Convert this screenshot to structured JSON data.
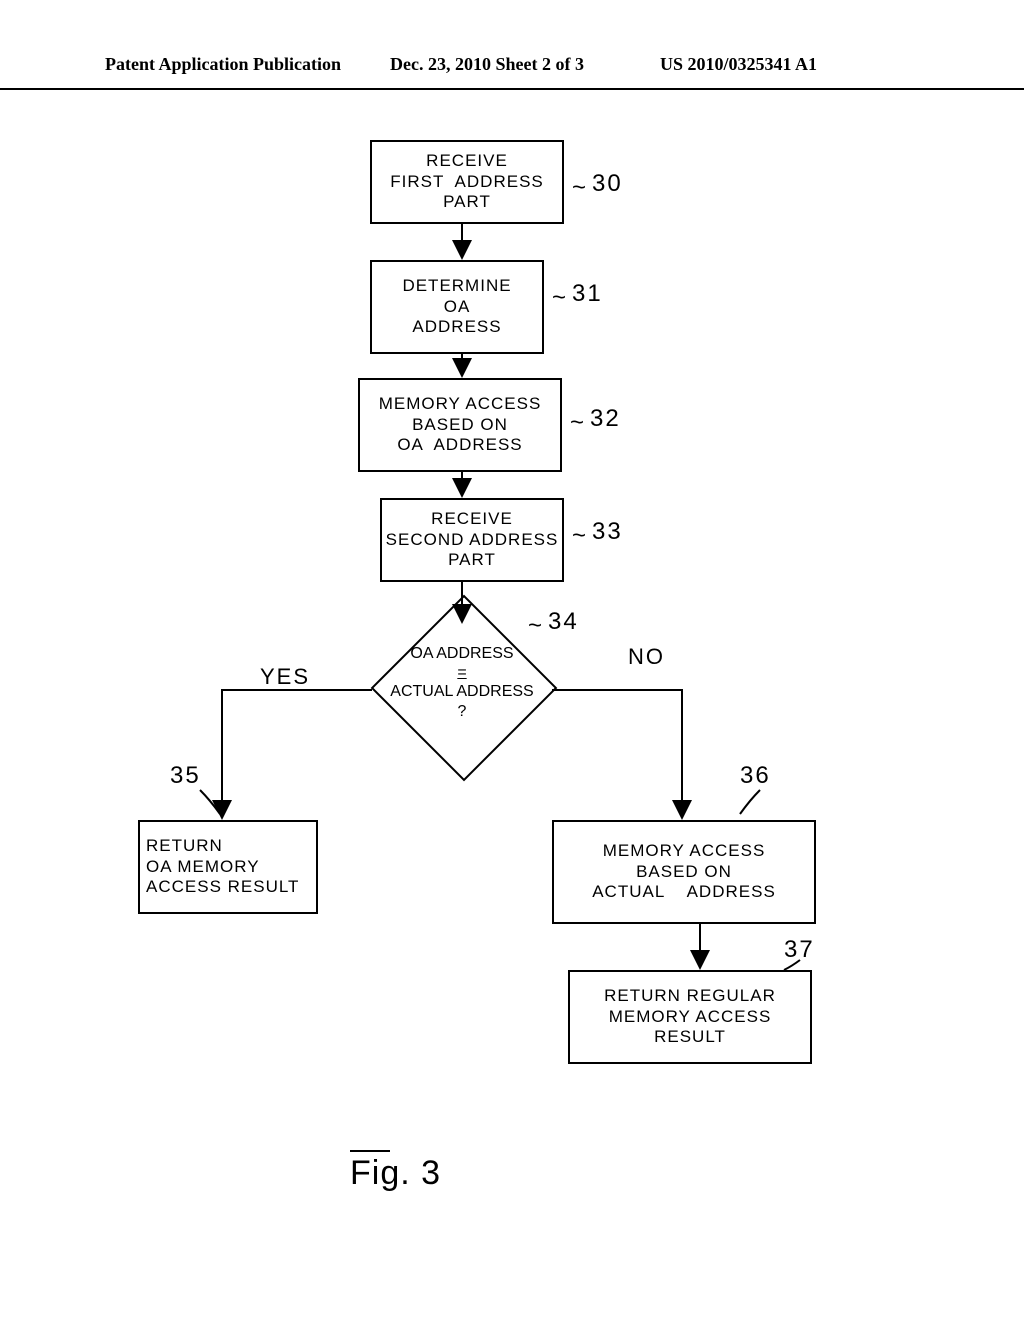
{
  "header": {
    "left": "Patent Application Publication",
    "center": "Dec. 23, 2010  Sheet 2 of 3",
    "right": "US 2010/0325341 A1"
  },
  "nodes": {
    "n30": {
      "l1": "RECEIVE",
      "l2": "FIRST  ADDRESS",
      "l3": "PART",
      "ref": "30"
    },
    "n31": {
      "l1": "DETERMINE",
      "l2": "OA",
      "l3": "ADDRESS",
      "ref": "31"
    },
    "n32": {
      "l1": "MEMORY ACCESS",
      "l2": "BASED ON",
      "l3": "OA  ADDRESS",
      "ref": "32"
    },
    "n33": {
      "l1": "RECEIVE",
      "l2": "SECOND ADDRESS",
      "l3": "PART",
      "ref": "33"
    },
    "n34": {
      "l1": "OA ADDRESS",
      "eq": "=",
      "l2": "ACTUAL ADDRESS",
      "q": "?",
      "ref": "34"
    },
    "n35": {
      "l1": "RETURN",
      "l2": "OA MEMORY",
      "l3": "ACCESS RESULT",
      "ref": "35"
    },
    "n36": {
      "l1": "MEMORY ACCESS",
      "l2": "BASED ON",
      "l3": "ACTUAL    ADDRESS",
      "ref": "36"
    },
    "n37": {
      "l1": "RETURN REGULAR",
      "l2": "MEMORY ACCESS",
      "l3": "RESULT",
      "ref": "37"
    }
  },
  "branches": {
    "yes": "YES",
    "no": "NO"
  },
  "figure_label": "Fig. 3",
  "chart_data": {
    "type": "flowchart",
    "title": "Fig. 3",
    "nodes": [
      {
        "id": 30,
        "type": "process",
        "text": "RECEIVE FIRST ADDRESS PART"
      },
      {
        "id": 31,
        "type": "process",
        "text": "DETERMINE OA ADDRESS"
      },
      {
        "id": 32,
        "type": "process",
        "text": "MEMORY ACCESS BASED ON OA ADDRESS"
      },
      {
        "id": 33,
        "type": "process",
        "text": "RECEIVE SECOND ADDRESS PART"
      },
      {
        "id": 34,
        "type": "decision",
        "text": "OA ADDRESS = ACTUAL ADDRESS ?"
      },
      {
        "id": 35,
        "type": "process",
        "text": "RETURN OA MEMORY ACCESS RESULT"
      },
      {
        "id": 36,
        "type": "process",
        "text": "MEMORY ACCESS BASED ON ACTUAL ADDRESS"
      },
      {
        "id": 37,
        "type": "process",
        "text": "RETURN REGULAR MEMORY ACCESS RESULT"
      }
    ],
    "edges": [
      {
        "from": 30,
        "to": 31
      },
      {
        "from": 31,
        "to": 32
      },
      {
        "from": 32,
        "to": 33
      },
      {
        "from": 33,
        "to": 34
      },
      {
        "from": 34,
        "to": 35,
        "label": "YES"
      },
      {
        "from": 34,
        "to": 36,
        "label": "NO"
      },
      {
        "from": 36,
        "to": 37
      }
    ]
  }
}
